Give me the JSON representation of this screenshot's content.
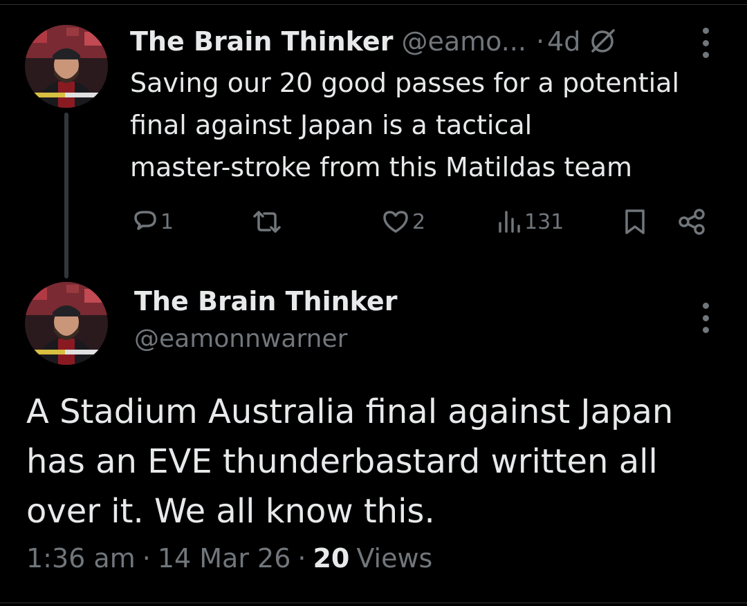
{
  "reply_tweet": {
    "author_name": "The Brain Thinker",
    "author_handle": "@eamo...",
    "dot": "·",
    "time_ago": "4d",
    "text": "Saving our 20 good passes for a potential\nfinal against Japan is a tactical\nmaster-stroke from this Matildas team",
    "actions": {
      "replies": "1",
      "retweets": "",
      "likes": "2",
      "views": "131"
    },
    "icons": [
      "avatar",
      "grok-icon",
      "more-icon",
      "reply-icon",
      "retweet-icon",
      "like-icon",
      "views-icon",
      "bookmark-icon",
      "share-icon"
    ]
  },
  "main_tweet": {
    "author_name": "The Brain Thinker",
    "author_handle": "@eamonnwarner",
    "text": "A Stadium Australia final against Japan\nhas an EVE thunderbastard written all\nover it. We all know this.",
    "time": "1:36 am",
    "sep1": "·",
    "date": "14 Mar 26",
    "sep2": "·",
    "views_count": "20",
    "views_label": "Views"
  },
  "colors": {
    "background": "#000000",
    "primary_text": "#e7e9ea",
    "secondary_text": "#71767b",
    "divider": "#2f3336"
  }
}
